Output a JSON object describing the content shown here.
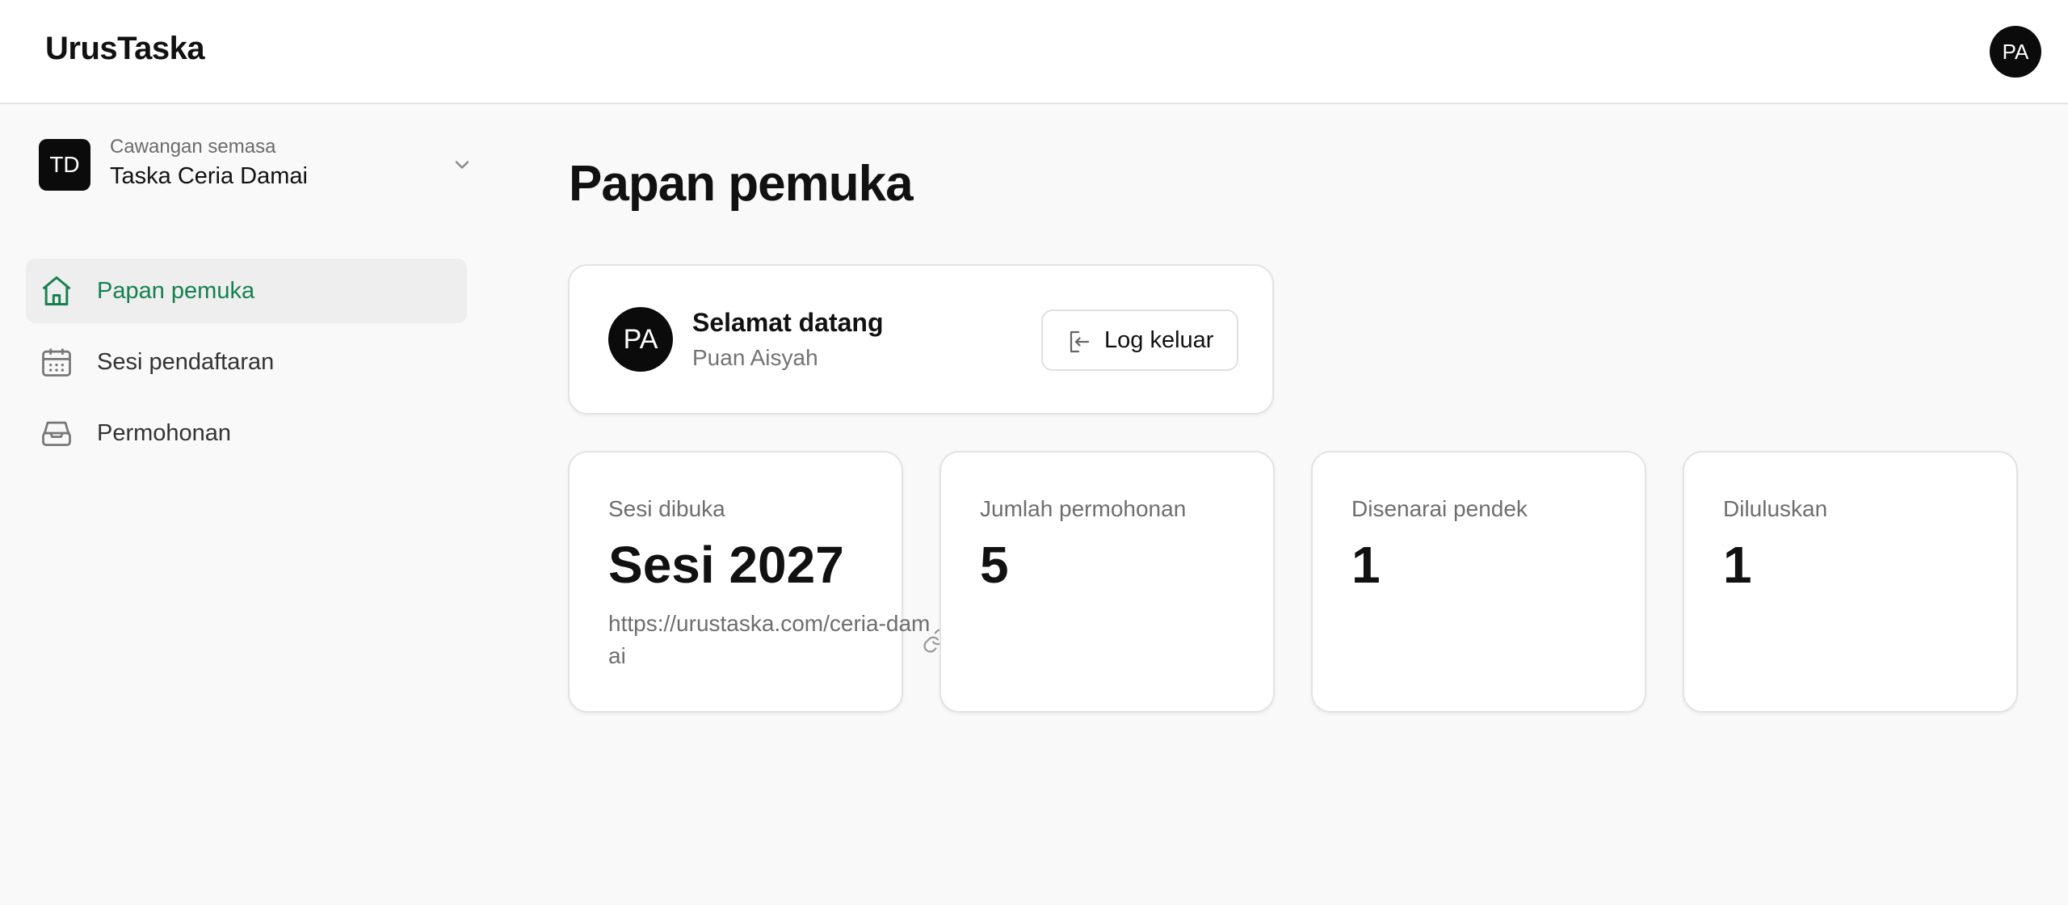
{
  "app": {
    "title": "UrusTaska",
    "user_initials": "PA"
  },
  "branch": {
    "badge": "TD",
    "caption": "Cawangan semasa",
    "name": "Taska Ceria Damai"
  },
  "sidebar": {
    "items": [
      {
        "label": "Papan pemuka",
        "icon": "home-icon",
        "active": true
      },
      {
        "label": "Sesi pendaftaran",
        "icon": "calendar-icon",
        "active": false
      },
      {
        "label": "Permohonan",
        "icon": "inbox-icon",
        "active": false
      }
    ]
  },
  "main": {
    "title": "Papan pemuka",
    "welcome": {
      "initials": "PA",
      "title": "Selamat datang",
      "name": "Puan Aisyah",
      "logout_label": "Log keluar"
    },
    "stats": [
      {
        "label": "Sesi dibuka",
        "value": "Sesi 2027",
        "url": "https://urustaska.com/ceria-damai"
      },
      {
        "label": "Jumlah permohonan",
        "value": "5"
      },
      {
        "label": "Disenarai pendek",
        "value": "1"
      },
      {
        "label": "Diluluskan",
        "value": "1"
      }
    ]
  },
  "colors": {
    "accent": "#16804f",
    "dark": "#0b0b0b",
    "background": "#f9f9f9"
  }
}
